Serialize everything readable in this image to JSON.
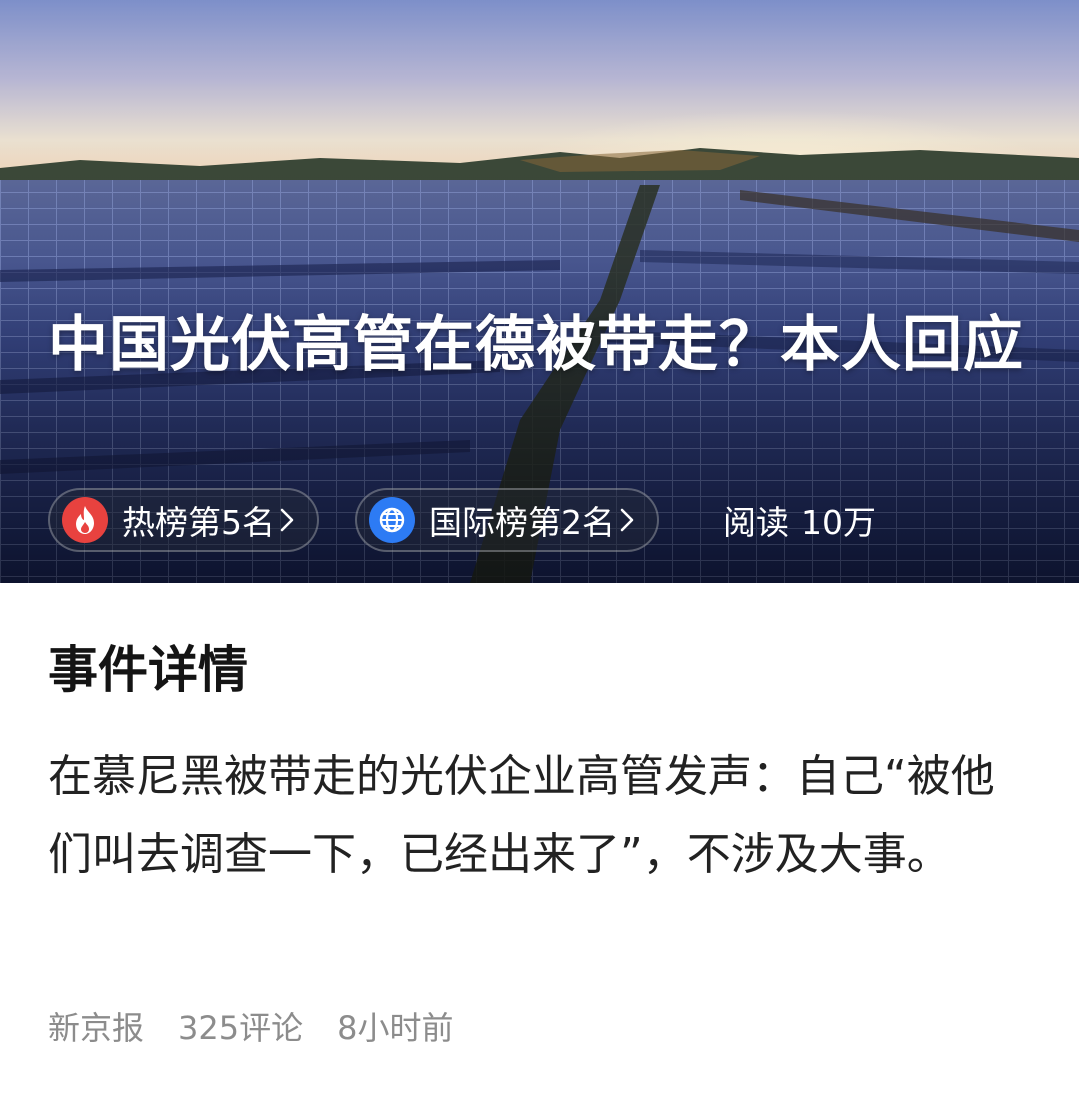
{
  "hero": {
    "title": "中国光伏高管在德被带走？本人回应",
    "badges": [
      {
        "label": "热榜第5名",
        "icon": "flame-icon",
        "color": "#e8423f"
      },
      {
        "label": "国际榜第2名",
        "icon": "globe-icon",
        "color": "#2d7bf4"
      }
    ],
    "read_label": "阅读",
    "read_count": "10万"
  },
  "details": {
    "heading": "事件详情",
    "summary": "在慕尼黑被带走的光伏企业高管发声：自己“被他们叫去调查一下，已经出来了”，不涉及大事。",
    "source": "新京报",
    "comments": "325评论",
    "time": "8小时前"
  }
}
